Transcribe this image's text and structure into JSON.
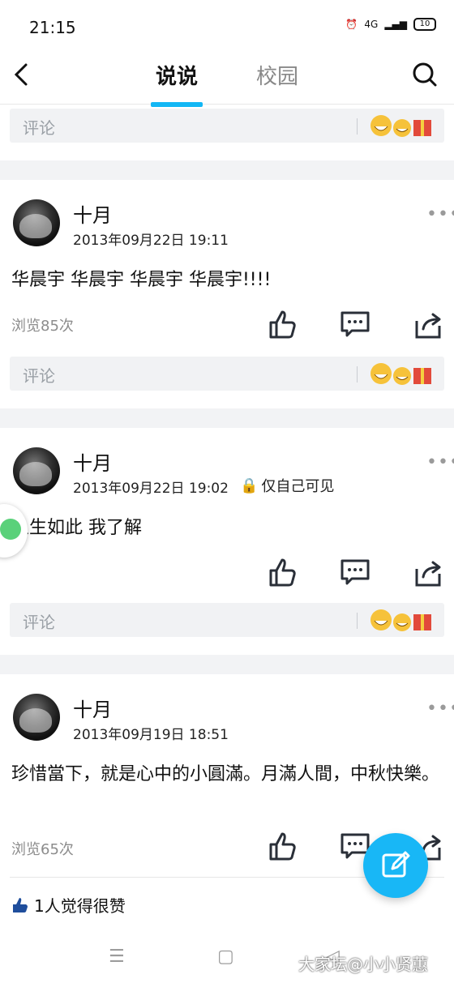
{
  "status": {
    "time": "21:15",
    "network": "4G",
    "battery": "10"
  },
  "nav": {
    "tabs": [
      {
        "label": "说说"
      },
      {
        "label": "校园"
      }
    ]
  },
  "comment_placeholder": "评论",
  "posts": [
    {
      "author": "十月",
      "date": "2013年09月22日 19:11",
      "text": "华晨宇 华晨宇 华晨宇 华晨宇!!!!",
      "views": "浏览85次"
    },
    {
      "author": "十月",
      "date": "2013年09月22日 19:02",
      "privacy": "仅自己可见",
      "text": "人生如此 我了解"
    },
    {
      "author": "十月",
      "date": "2013年09月19日 18:51",
      "text": "珍惜當下，就是心中的小圓滿。月滿人間，中秋快樂。",
      "views": "浏览65次",
      "likes": "1人觉得很赞"
    }
  ],
  "watermark": "大家坛@小小贤蕙",
  "colors": {
    "accent": "#12b7f5",
    "fab": "#18b7f6",
    "chat_float": "#5ad17a"
  }
}
